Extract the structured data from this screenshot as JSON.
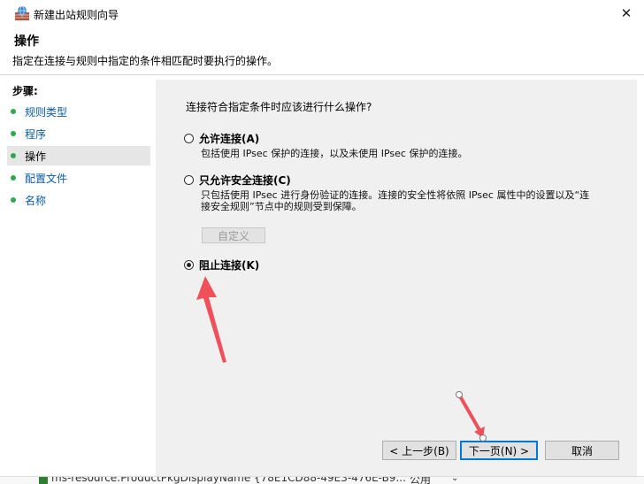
{
  "window": {
    "title": "新建出站规则向导",
    "close_glyph": "✕"
  },
  "header": {
    "title": "操作",
    "description": "指定在连接与规则中指定的条件相匹配时要执行的操作。"
  },
  "steps": {
    "title": "步骤:",
    "items": [
      {
        "label": "规则类型"
      },
      {
        "label": "程序"
      },
      {
        "label": "操作"
      },
      {
        "label": "配置文件"
      },
      {
        "label": "名称"
      }
    ],
    "current_index": 2,
    "dot_color": "#2fa84f"
  },
  "main": {
    "question": "连接符合指定条件时应该进行什么操作?",
    "options": [
      {
        "label": "允许连接(A)",
        "description": "包括使用 IPsec 保护的连接，以及未使用 IPsec 保护的连接。",
        "checked": false
      },
      {
        "label": "只允许安全连接(C)",
        "description": "只包括使用 IPsec 进行身份验证的连接。连接的安全性将依照 IPsec 属性中的设置以及“连接安全规则”节点中的规则受到保障。",
        "checked": false
      },
      {
        "label": "阻止连接(K)",
        "description": "",
        "checked": true
      }
    ],
    "customize_button": "自定义"
  },
  "footer": {
    "back": "< 上一步(B)",
    "next": "下一页(N) >",
    "cancel": "取消"
  },
  "background_window": {
    "row_text": "ms-resource:ProductPkgDisplayName   {78E1CD88-49E3-476E-B9...",
    "column_value": "公用",
    "dropdown_glyph": "⌄"
  },
  "colors": {
    "accent": "#0078d7",
    "annotation": "#f0505a",
    "link": "#0a5aa6"
  },
  "icons": {
    "app": "firewall-icon",
    "close": "close-icon"
  }
}
